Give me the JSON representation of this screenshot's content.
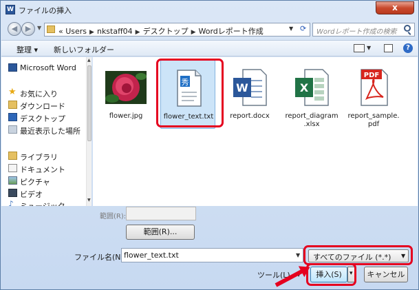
{
  "window": {
    "title": "ファイルの挿入",
    "close_label": "x",
    "app_badge": "W"
  },
  "address": {
    "segments": [
      "«",
      "Users",
      "nkstaff04",
      "デスクトップ",
      "Wordレポート作成"
    ],
    "search_placeholder": "Wordレポート作成の検索"
  },
  "toolbar": {
    "organize_label": "整理 ▾",
    "new_folder_label": "新しいフォルダー",
    "help_label": "?"
  },
  "sidebar": {
    "items": [
      {
        "label": "Microsoft Word",
        "icon": "word-icon"
      },
      {
        "label": "お気に入り",
        "icon": "star-icon"
      },
      {
        "label": "ダウンロード",
        "icon": "download-folder-icon"
      },
      {
        "label": "デスクトップ",
        "icon": "desktop-icon"
      },
      {
        "label": "最近表示した場所",
        "icon": "recent-places-icon"
      },
      {
        "label": "ライブラリ",
        "icon": "library-icon"
      },
      {
        "label": "ドキュメント",
        "icon": "documents-icon"
      },
      {
        "label": "ピクチャ",
        "icon": "pictures-icon"
      },
      {
        "label": "ビデオ",
        "icon": "videos-icon"
      },
      {
        "label": "ミュージック",
        "icon": "music-icon"
      }
    ]
  },
  "files": [
    {
      "name": "flower.jpg",
      "icon": "photo-icon",
      "selected": false
    },
    {
      "name": "flower_text.txt",
      "icon": "text-file-icon",
      "selected": true
    },
    {
      "name": "report.docx",
      "icon": "word-document-icon",
      "selected": false
    },
    {
      "name": "report_diagram\n.xlsx",
      "icon": "excel-document-icon",
      "selected": false
    },
    {
      "name": "report_sample.\npdf",
      "icon": "pdf-document-icon",
      "selected": false
    }
  ],
  "bottom": {
    "range_label": "範囲(R):",
    "range_button": "範囲(R)...",
    "filename_label": "ファイル名(N):",
    "filename_value": "flower_text.txt",
    "filter_value": "すべてのファイル (*.*)",
    "tools_label": "ツール(L)",
    "insert_label": "挿入(S)",
    "cancel_label": "キャンセル"
  },
  "colors": {
    "highlight": "#e5001f",
    "selection": "#cce4f8",
    "word_blue": "#2b579a",
    "excel_green": "#217346",
    "pdf_red": "#d7261e"
  }
}
